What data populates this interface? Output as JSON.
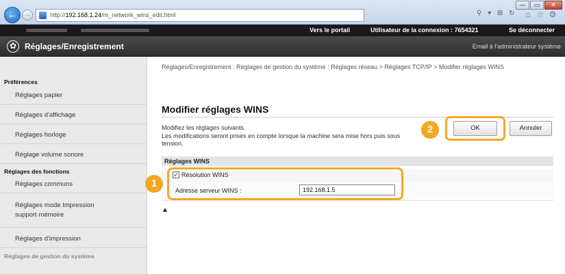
{
  "browser": {
    "url_prefix": "http://",
    "url_host": "192.168.1.24",
    "url_path": "/m_network_wins_edit.html",
    "search_tools": "⚲ ▾ ⊞ ↻",
    "tool_icons": [
      "home-icon",
      "star-icon",
      "gear-icon"
    ],
    "window_controls": [
      "—",
      "▭",
      "✕"
    ]
  },
  "top_bar": {
    "portal_link": "Vers le portail",
    "login_user": "Utilisateur de la connexion :  7654321",
    "logout_link": "Se déconnecter"
  },
  "header": {
    "title": "Réglages/Enregistrement",
    "admin_mail": "Email à l'administrateur système"
  },
  "sidebar": {
    "sections": [
      {
        "heading": "Préférences",
        "items": [
          "Réglages papier",
          "Réglages d'affichage",
          "Réglages horloge",
          "Réglage volume sonore"
        ]
      },
      {
        "heading": "Réglages des fonctions",
        "items": [
          "Réglages communs",
          "Réglages mode Impression\nsupport mémoire",
          "Réglages d'impression"
        ]
      },
      {
        "heading": "Réglages de gestion du système",
        "items": []
      }
    ]
  },
  "main": {
    "breadcrumb": "Réglages/Enregistrement : Réglages de gestion du système : Réglages réseau > Réglages TCP/IP > Modifier réglages WINS",
    "page_title": "Modifier réglages WINS",
    "intro_line1": "Modifiez les réglages suivants.",
    "intro_line2": "Les modifications seront prises en compte lorsque la machine sera mise hors puis sous tension.",
    "ok_label": "OK",
    "cancel_label": "Annuler",
    "section_title": "Réglages WINS",
    "wins_resolution_label": "Résolution WINS",
    "wins_resolution_checked": true,
    "server_label": "Adresse serveur WINS :",
    "server_value": "192.168.1.5",
    "to_top": "▲"
  },
  "callouts": {
    "step1": "1",
    "step2": "2"
  },
  "colors": {
    "highlight": "#f5a623",
    "header_bg": "#3b3b3b",
    "topbar_bg": "#191919"
  }
}
